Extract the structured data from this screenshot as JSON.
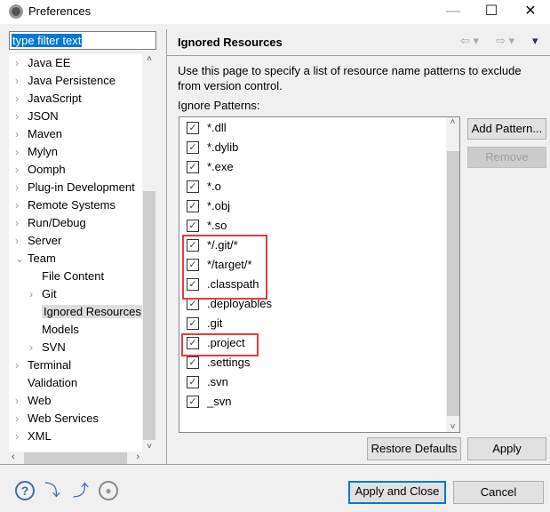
{
  "window": {
    "title": "Preferences",
    "minimize": "—",
    "maximize": "☐",
    "close": "✕"
  },
  "filter": {
    "value": "type filter text"
  },
  "tree": [
    {
      "label": "Java EE",
      "level": 0,
      "expandable": true
    },
    {
      "label": "Java Persistence",
      "level": 0,
      "expandable": true
    },
    {
      "label": "JavaScript",
      "level": 0,
      "expandable": true
    },
    {
      "label": "JSON",
      "level": 0,
      "expandable": true
    },
    {
      "label": "Maven",
      "level": 0,
      "expandable": true
    },
    {
      "label": "Mylyn",
      "level": 0,
      "expandable": true
    },
    {
      "label": "Oomph",
      "level": 0,
      "expandable": true
    },
    {
      "label": "Plug-in Development",
      "level": 0,
      "expandable": true
    },
    {
      "label": "Remote Systems",
      "level": 0,
      "expandable": true
    },
    {
      "label": "Run/Debug",
      "level": 0,
      "expandable": true
    },
    {
      "label": "Server",
      "level": 0,
      "expandable": true
    },
    {
      "label": "Team",
      "level": 0,
      "expandable": true,
      "expanded": true
    },
    {
      "label": "File Content",
      "level": 1,
      "expandable": false
    },
    {
      "label": "Git",
      "level": 1,
      "expandable": true
    },
    {
      "label": "Ignored Resources",
      "level": 1,
      "expandable": false,
      "selected": true
    },
    {
      "label": "Models",
      "level": 1,
      "expandable": false
    },
    {
      "label": "SVN",
      "level": 1,
      "expandable": true
    },
    {
      "label": "Terminal",
      "level": 0,
      "expandable": true
    },
    {
      "label": "Validation",
      "level": 0,
      "expandable": false
    },
    {
      "label": "Web",
      "level": 0,
      "expandable": true
    },
    {
      "label": "Web Services",
      "level": 0,
      "expandable": true
    },
    {
      "label": "XML",
      "level": 0,
      "expandable": true
    }
  ],
  "page": {
    "title": "Ignored Resources",
    "description": "Use this page to specify a list of resource name patterns to exclude from version control.",
    "patterns_label": "Ignore Patterns:",
    "patterns": [
      {
        "text": "*.dll",
        "checked": true
      },
      {
        "text": "*.dylib",
        "checked": true
      },
      {
        "text": "*.exe",
        "checked": true
      },
      {
        "text": "*.o",
        "checked": true
      },
      {
        "text": "*.obj",
        "checked": true
      },
      {
        "text": "*.so",
        "checked": true
      },
      {
        "text": "*/.git/*",
        "checked": true,
        "highlighted": true
      },
      {
        "text": "*/target/*",
        "checked": true,
        "highlighted": true
      },
      {
        "text": ".classpath",
        "checked": true,
        "highlighted": true
      },
      {
        "text": ".deployables",
        "checked": true
      },
      {
        "text": ".git",
        "checked": true
      },
      {
        "text": ".project",
        "checked": true,
        "highlighted": true
      },
      {
        "text": ".settings",
        "checked": true
      },
      {
        "text": ".svn",
        "checked": true
      },
      {
        "text": "_svn",
        "checked": true
      }
    ],
    "add_pattern": "Add Pattern...",
    "remove": "Remove",
    "restore_defaults": "Restore Defaults",
    "apply": "Apply"
  },
  "footer": {
    "apply_close": "Apply and Close",
    "cancel": "Cancel"
  },
  "highlight_color": "#e8383d"
}
